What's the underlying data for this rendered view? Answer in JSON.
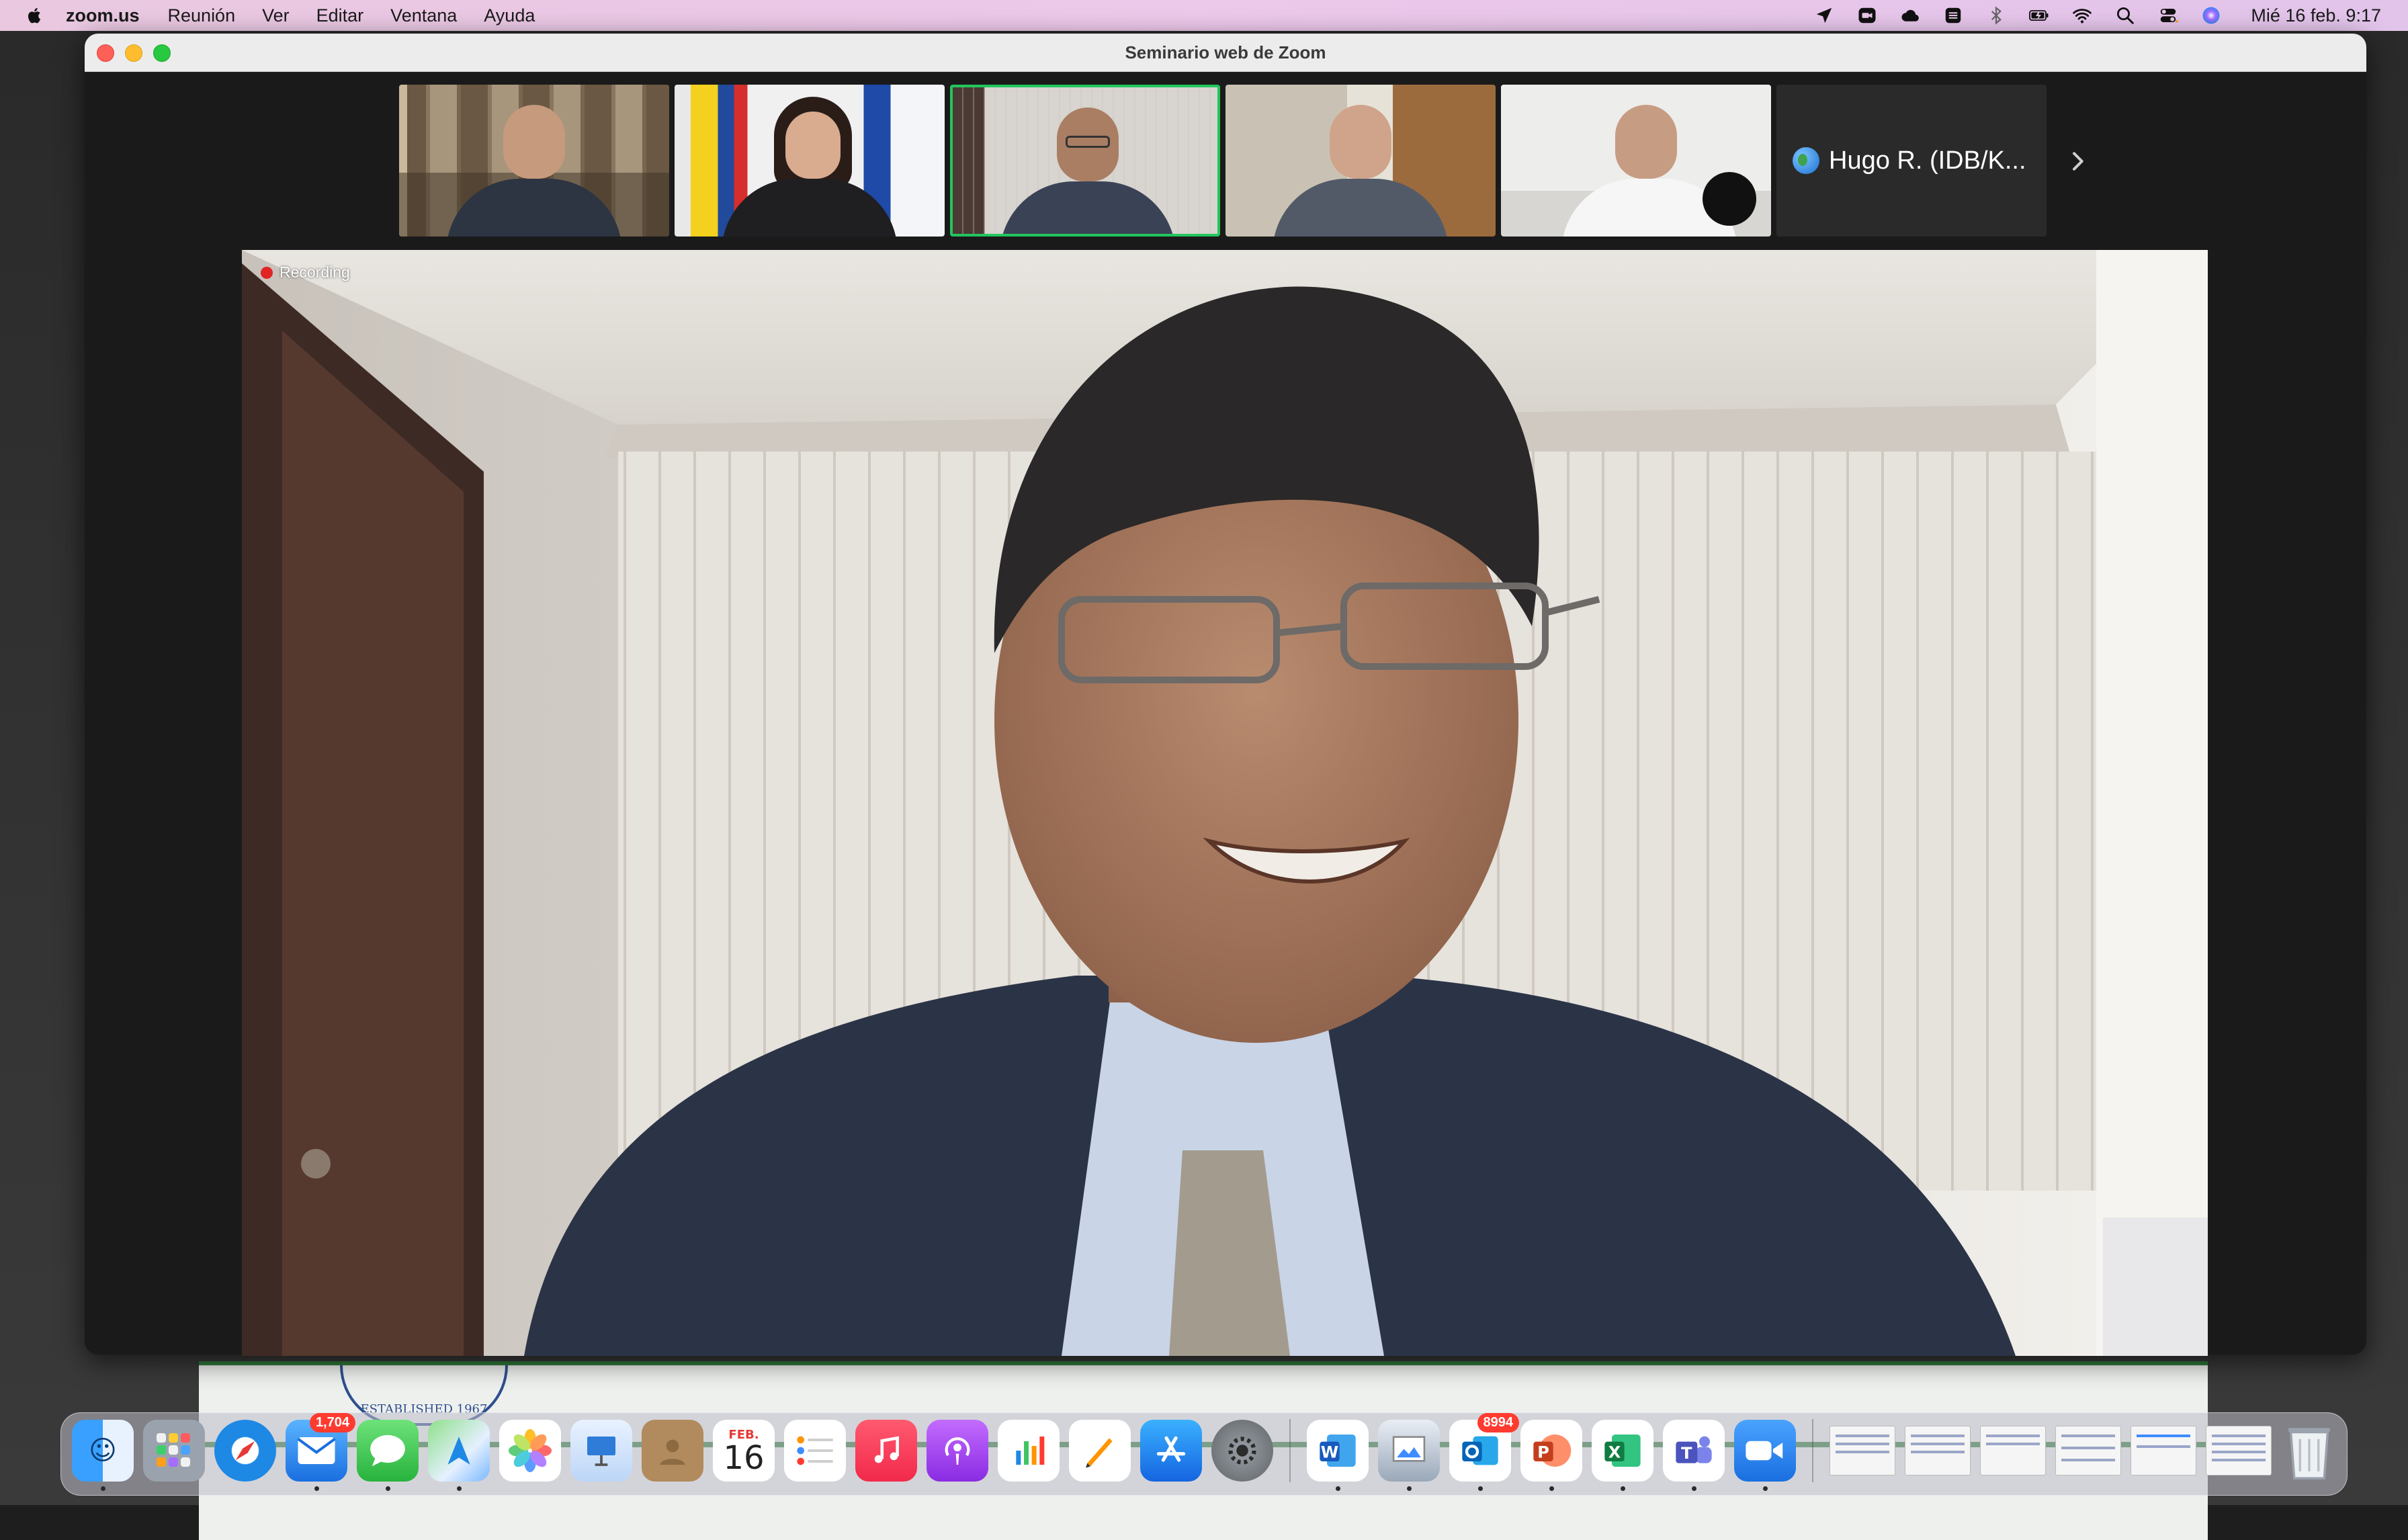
{
  "menubar": {
    "app_name": "zoom.us",
    "items": [
      "Reunión",
      "Ver",
      "Editar",
      "Ventana",
      "Ayuda"
    ],
    "clock": "Mié 16 feb.  9:17"
  },
  "window": {
    "title": "Seminario web de Zoom"
  },
  "participants": {
    "more_name": "Hugo R. (IDB/K..."
  },
  "main_video": {
    "recording_label": "Recording"
  },
  "desktop_doc": {
    "seal_text": "ESTABLISHED 1967"
  },
  "dock": {
    "mail_badge": "1,704",
    "calendar_month": "FEB.",
    "calendar_day": "16",
    "outlook_badge": "8994"
  },
  "colors": {
    "active_speaker_border": "#22c55e",
    "recording_dot": "#e02424",
    "badge": "#ff3b30"
  }
}
